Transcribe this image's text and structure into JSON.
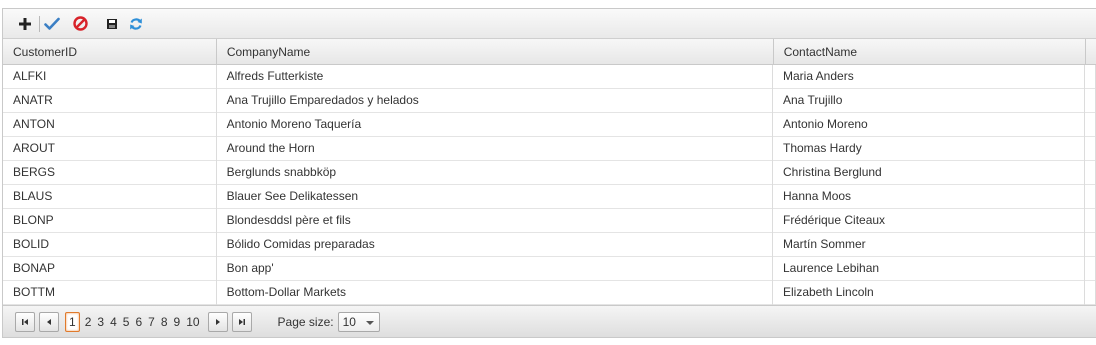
{
  "toolbar": {
    "buttons": [
      {
        "name": "add-icon",
        "glyph": "plus"
      },
      {
        "name": "check-icon",
        "glyph": "check"
      },
      {
        "name": "cancel-icon",
        "glyph": "no"
      },
      {
        "name": "save-icon",
        "glyph": "floppy"
      },
      {
        "name": "refresh-icon",
        "glyph": "refresh"
      }
    ]
  },
  "grid": {
    "columns": [
      "CustomerID",
      "CompanyName",
      "ContactName"
    ],
    "rows": [
      [
        "ALFKI",
        "Alfreds Futterkiste",
        "Maria Anders"
      ],
      [
        "ANATR",
        "Ana Trujillo Emparedados y helados",
        "Ana Trujillo"
      ],
      [
        "ANTON",
        "Antonio Moreno Taquería",
        "Antonio Moreno"
      ],
      [
        "AROUT",
        "Around the Horn",
        "Thomas Hardy"
      ],
      [
        "BERGS",
        "Berglunds snabbköp",
        "Christina Berglund"
      ],
      [
        "BLAUS",
        "Blauer See Delikatessen",
        "Hanna Moos"
      ],
      [
        "BLONP",
        "Blondesddsl père et fils",
        "Frédérique Citeaux"
      ],
      [
        "BOLID",
        "Bólido Comidas preparadas",
        "Martín Sommer"
      ],
      [
        "BONAP",
        "Bon app'",
        "Laurence Lebihan"
      ],
      [
        "BOTTM",
        "Bottom-Dollar Markets",
        "Elizabeth Lincoln"
      ]
    ]
  },
  "pager": {
    "pages": [
      "1",
      "2",
      "3",
      "4",
      "5",
      "6",
      "7",
      "8",
      "9",
      "10"
    ],
    "current_page": "1",
    "page_size_label": "Page size:",
    "page_size_value": "10"
  },
  "colors": {
    "accent_orange": "#e07a2c",
    "check_blue": "#3b7fc4",
    "cancel_red": "#d8232a",
    "refresh_blue": "#2e8fd8"
  }
}
